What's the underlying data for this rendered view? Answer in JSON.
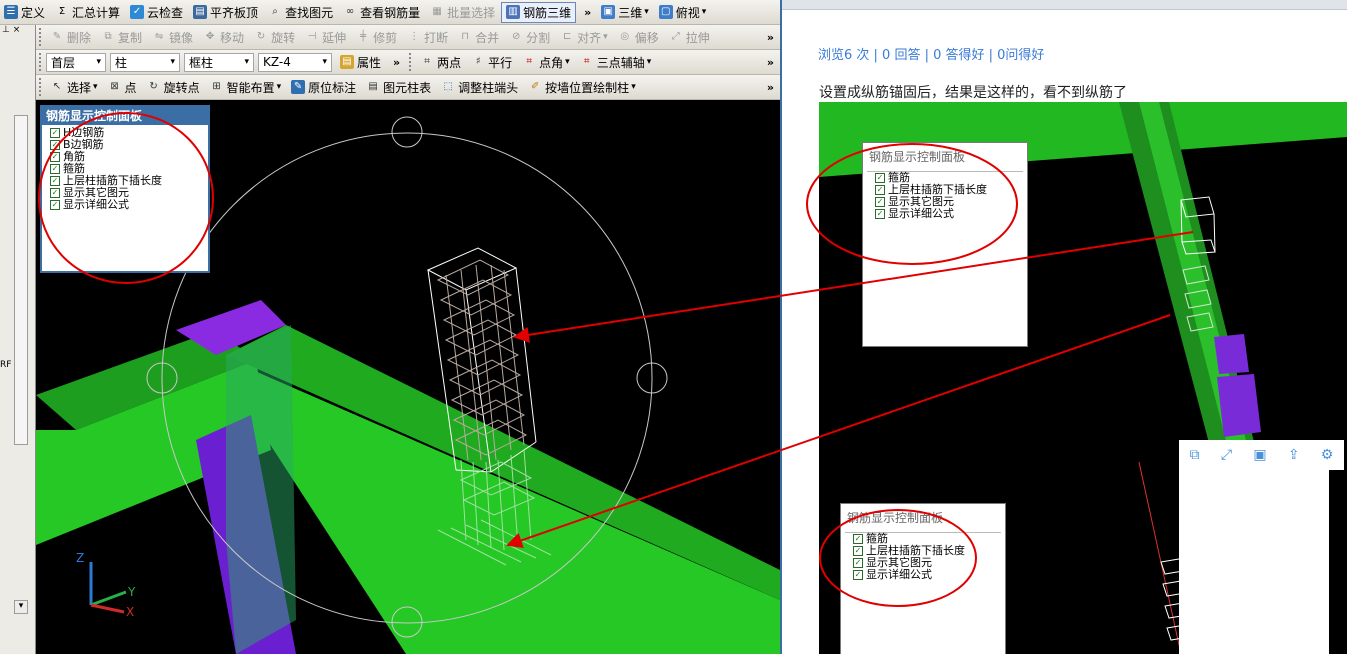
{
  "toolbar1": {
    "items": [
      "定义",
      "汇总计算",
      "云检查",
      "平齐板顶",
      "查找图元",
      "查看钢筋量",
      "批量选择",
      "钢筋三维",
      "三维",
      "俯视"
    ]
  },
  "toolbar2": {
    "items": [
      "删除",
      "复制",
      "镜像",
      "移动",
      "旋转",
      "延伸",
      "修剪",
      "打断",
      "合并",
      "分割",
      "对齐",
      "偏移",
      "拉伸"
    ]
  },
  "toolbar3": {
    "floor": "首层",
    "category": "柱",
    "type": "框柱",
    "element": "KZ-4",
    "props": "属性",
    "two_point": "两点",
    "parallel": "平行",
    "point_angle": "点角",
    "three_axis": "三点辅轴"
  },
  "toolbar4": {
    "items": [
      "选择",
      "点",
      "旋转点",
      "智能布置",
      "原位标注",
      "图元柱表",
      "调整柱端头",
      "按墙位置绘制柱"
    ]
  },
  "sidebar": {
    "code": "RF"
  },
  "left_panel": {
    "title": "钢筋显示控制面板",
    "options": [
      "H边钢筋",
      "B边钢筋",
      "角筋",
      "箍筋",
      "上层柱插筋下插长度",
      "显示其它图元",
      "显示详细公式"
    ]
  },
  "axes": {
    "z": "Z",
    "y": "Y",
    "x": "X"
  },
  "right": {
    "stats": "浏览6 次 | 0 回答 | 0 答得好 | 0问得好",
    "question": "设置成纵筋锚固后，结果是这样的，看不到纵筋了",
    "panel1": {
      "title": "钢筋显示控制面板",
      "options": [
        "箍筋",
        "上层柱插筋下插长度",
        "显示其它图元",
        "显示详细公式"
      ]
    },
    "panel2": {
      "title": "钢筋显示控制面板",
      "options": [
        "箍筋",
        "上层柱插筋下插长度",
        "显示其它图元",
        "显示详细公式"
      ]
    }
  },
  "colors": {
    "beam": "#1fb81f",
    "column": "#6a1fd0",
    "annotation": "#e00000"
  }
}
